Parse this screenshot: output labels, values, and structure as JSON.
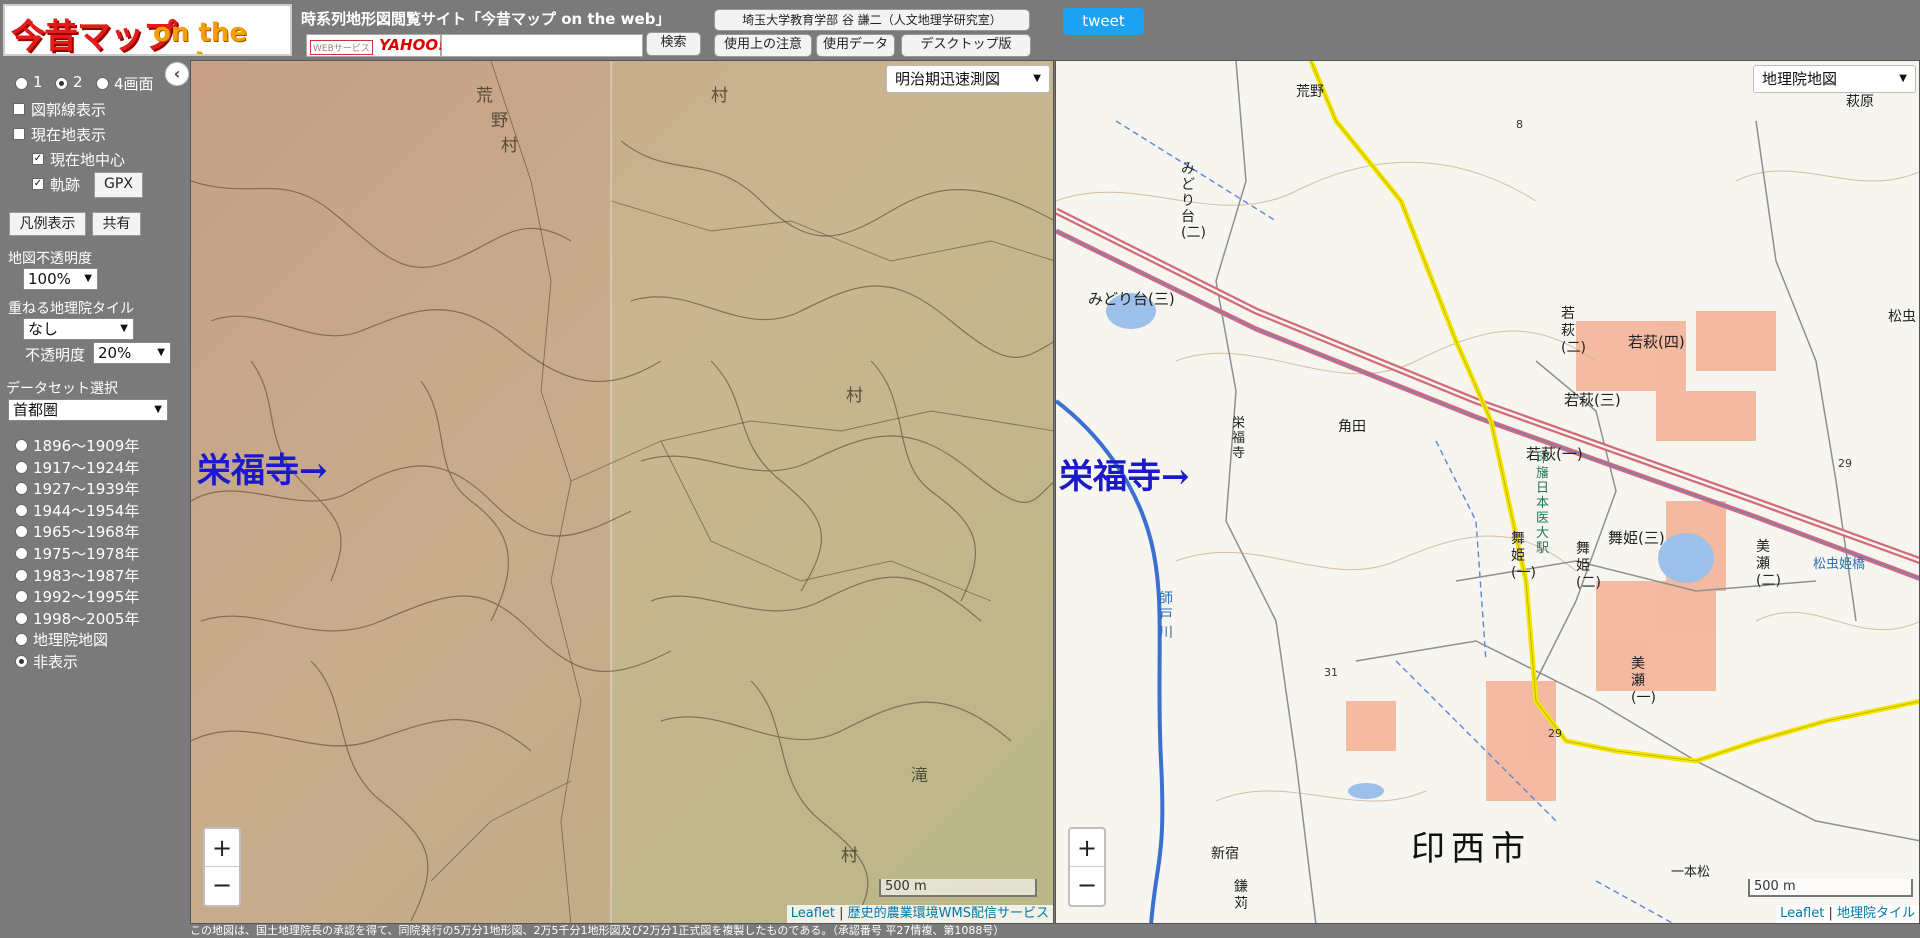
{
  "header": {
    "logo_text_main": "今昔マップ",
    "logo_text_sub": "on the web",
    "site_title": "時系列地形図閲覧サイト「今昔マップ on the web」",
    "yahoo_web_service": "WEBサービス",
    "yahoo_label": "YAHOO!",
    "search_value": "",
    "search_button": "検索",
    "affiliation_button": "埼玉大学教育学部 谷 謙二（人文地理学研究室）",
    "notice_button": "使用上の注意",
    "data_button": "使用データ",
    "desktop_button": "デスクトップ版",
    "tweet_button": "tweet"
  },
  "sidebar": {
    "collapse_label": "‹",
    "screen_options": [
      {
        "label": "1",
        "selected": false
      },
      {
        "label": "2",
        "selected": true
      },
      {
        "label": "4画面",
        "selected": false
      }
    ],
    "map_frame_label": "図郭線表示",
    "current_location_label": "現在地表示",
    "center_current_label": "現在地中心",
    "track_label": "軌跡",
    "gpx_button": "GPX",
    "legend_button": "凡例表示",
    "share_button": "共有",
    "opacity_label": "地図不透明度",
    "opacity_value": "100%",
    "overlay_tile_label": "重ねる地理院タイル",
    "overlay_tile_value": "なし",
    "overlay_opacity_label": "不透明度",
    "overlay_opacity_value": "20%",
    "dataset_label": "データセット選択",
    "dataset_value": "首都圏",
    "periods": [
      {
        "label": "1896～1909年",
        "selected": false
      },
      {
        "label": "1917～1924年",
        "selected": false
      },
      {
        "label": "1927～1939年",
        "selected": false
      },
      {
        "label": "1944～1954年",
        "selected": false
      },
      {
        "label": "1965～1968年",
        "selected": false
      },
      {
        "label": "1975～1978年",
        "selected": false
      },
      {
        "label": "1983～1987年",
        "selected": false
      },
      {
        "label": "1992～1995年",
        "selected": false
      },
      {
        "label": "1998～2005年",
        "selected": false
      },
      {
        "label": "地理院地図",
        "selected": false
      },
      {
        "label": "非表示",
        "selected": true
      }
    ]
  },
  "left_map": {
    "layer_select": "明治期迅速測図",
    "landmark": "栄福寺→",
    "zoom_in": "+",
    "zoom_out": "−",
    "scale": "500 m",
    "attribution_leaflet": "Leaflet",
    "attribution_sep": " | ",
    "attribution_source": "歴史的農業環境WMS配信サービス",
    "map_labels": [
      "荒野村",
      "村",
      "村",
      "村",
      "滝"
    ]
  },
  "right_map": {
    "layer_select": "地理院地図",
    "landmark": "栄福寺→",
    "zoom_in": "+",
    "zoom_out": "−",
    "scale": "500 m",
    "attribution_leaflet": "Leaflet",
    "attribution_sep": " | ",
    "attribution_source": "地理院タイル",
    "map_labels": {
      "city": "印西市",
      "midori2": "みどり台(二)",
      "midori3": "みどり台(三)",
      "wakahagi4": "若萩(四)",
      "wakahagi3": "若萩(三)",
      "wakahagi1": "若萩(一)",
      "wakahagi2": "若萩(二)",
      "maihime3": "舞姫(三)",
      "maihime1": "舞姫(一)",
      "maihime2": "舞姫(二)",
      "station": "印旛日本医大駅",
      "kakuta": "角田",
      "eifukuji": "栄福寺",
      "kouya": "荒野",
      "shinjuku": "新宿",
      "misose": "美瀬(一)",
      "misose2": "美瀬(二)",
      "river": "師戸川",
      "hagiwara": "萩原",
      "matsumushi": "松虫",
      "matsumushihime": "松虫姫橋",
      "ipponmatsu": "一本松",
      "kamakari": "鎌苅",
      "elev1": "31",
      "elev2": "29",
      "elev3": "29",
      "elev4": "8"
    }
  },
  "footer_note": "この地図は、国土地理院長の承認を得て、同院発行の5万分1地形図、2万5千分1地形図及び2万分1正式図を複製したものである。（承認番号 平27情複、第1088号）",
  "colors": {
    "background": "#7a7a7a",
    "tweet": "#1da1f2",
    "landmark": "#1a1acc",
    "railway": "#d26b7a",
    "road_yellow": "#f3e600",
    "residential": "#f2a68a"
  }
}
